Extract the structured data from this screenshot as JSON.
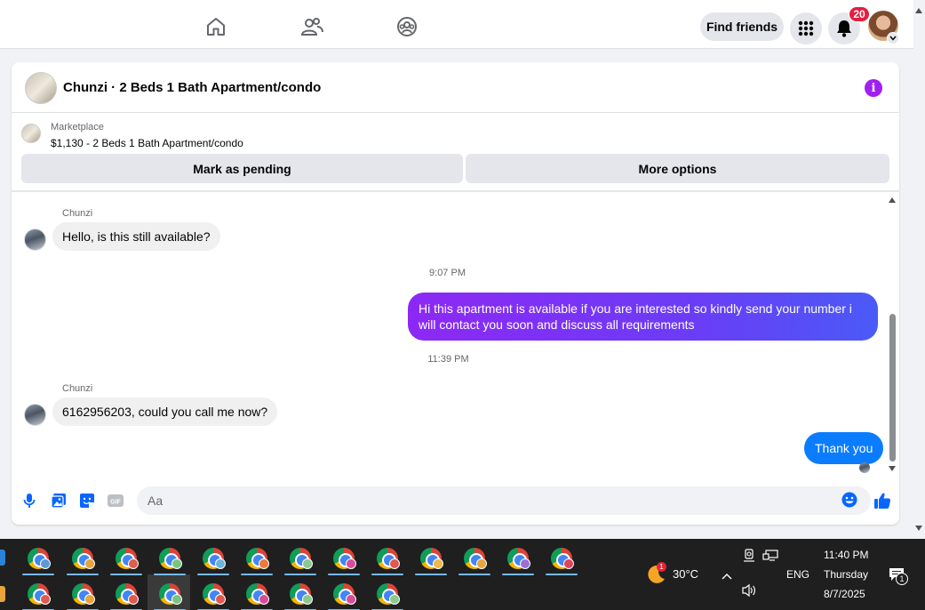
{
  "nav": {
    "find_friends": "Find friends",
    "notifications_count": "20"
  },
  "chat": {
    "header_title": "Chunzi · 2 Beds 1 Bath Apartment/condo",
    "marketplace_label": "Marketplace",
    "listing_price": "$1,130 - 2 Beds 1 Bath Apartment/condo",
    "mark_pending": "Mark as pending",
    "more_options": "More options",
    "messages": [
      {
        "sender": "Chunzi",
        "text": "Hello, is this still available?"
      },
      {
        "time": "9:07 PM"
      },
      {
        "text": "Hi this apartment is available if you are interested so kindly send your number i will contact you soon and discuss all requirements"
      },
      {
        "time": "11:39 PM"
      },
      {
        "sender": "Chunzi",
        "text": "6162956203, could you call me now?"
      },
      {
        "text": "Thank you"
      }
    ],
    "composer_placeholder": "Aa"
  },
  "taskbar": {
    "weather_temp": "30°C",
    "weather_badge": "1",
    "language": "ENG",
    "time": "11:40 PM",
    "day": "Thursday",
    "date": "8/7/2025",
    "notification_count": "1",
    "badge_colors": [
      "#5a9bd5",
      "#e8a33d",
      "#e05a4f",
      "#7bc47f",
      "#6fb3d8",
      "#f07a3a",
      "#8cc98e",
      "#d94c9a",
      "#e05a4f",
      "#f2b84b",
      "#e8a33d",
      "#9b6fd6",
      "#e0445a",
      "#e05a4f",
      "#e8a33d",
      "#e05a4f",
      "#7bc47f",
      "#e05a4f",
      "#d94c9a",
      "#8cc98e",
      "#d94c9a",
      "#8cc98e"
    ]
  }
}
